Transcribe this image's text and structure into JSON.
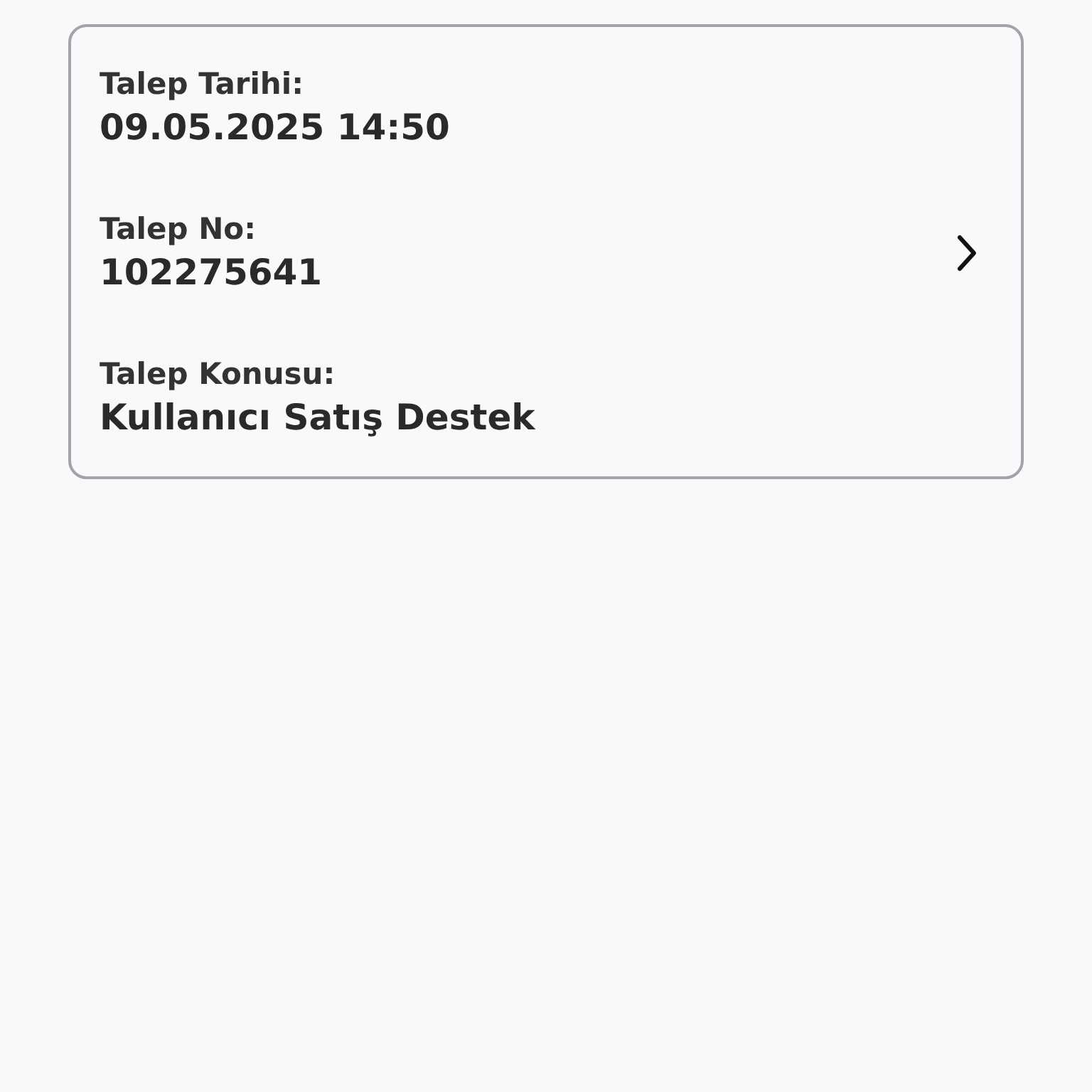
{
  "request_card": {
    "fields": [
      {
        "label": "Talep Tarihi:",
        "value": "09.05.2025 14:50"
      },
      {
        "label": "Talep No:",
        "value": "102275641"
      },
      {
        "label": "Talep Konusu:",
        "value": "Kullanıcı Satış Destek"
      }
    ]
  }
}
